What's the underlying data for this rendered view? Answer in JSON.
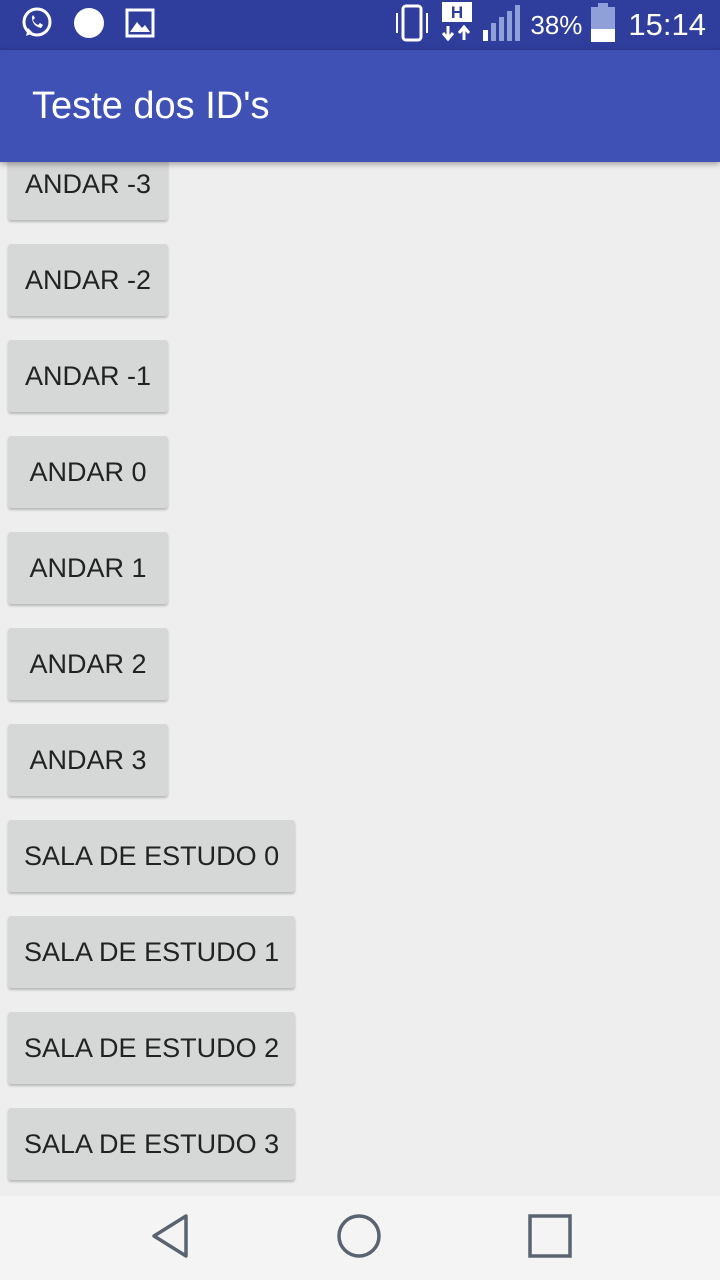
{
  "status_bar": {
    "battery_percent": "38%",
    "time": "15:14",
    "network_type": "H",
    "icons": [
      "whatsapp-icon",
      "notification-dot-icon",
      "gallery-icon",
      "vibrate-icon",
      "network-h-icon",
      "signal-icon",
      "battery-icon"
    ],
    "battery_level": 0.38
  },
  "app_bar": {
    "title": "Teste dos ID's"
  },
  "buttons": [
    {
      "label": "ANDAR -3"
    },
    {
      "label": "ANDAR -2"
    },
    {
      "label": "ANDAR -1"
    },
    {
      "label": "ANDAR 0"
    },
    {
      "label": "ANDAR 1"
    },
    {
      "label": "ANDAR 2"
    },
    {
      "label": "ANDAR 3"
    },
    {
      "label": "SALA DE ESTUDO 0"
    },
    {
      "label": "SALA DE ESTUDO 1"
    },
    {
      "label": "SALA DE ESTUDO 2"
    },
    {
      "label": "SALA DE ESTUDO 3"
    }
  ],
  "nav_bar": {
    "icons": [
      "back-icon",
      "home-icon",
      "recents-icon"
    ]
  },
  "colors": {
    "status_bar": "#2f3d9c",
    "app_bar": "#3f51b5",
    "background": "#eeeeee",
    "button": "#d6d7d7",
    "button_text": "#222222",
    "nav_bar": "#f4f4f4",
    "nav_icon": "#5a6470"
  }
}
